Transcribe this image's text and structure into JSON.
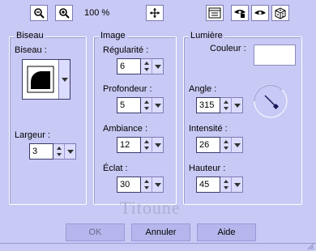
{
  "toolbar": {
    "zoom_out_icon": "zoom-out-icon",
    "zoom_in_icon": "zoom-in-icon",
    "zoom_level": "100 %",
    "pan_icon": "move-icon",
    "preview_icon": "preview-panel-icon",
    "eye_lock_icon": "lock-eye-icon",
    "eye_icon": "eye-icon",
    "random_icon": "dice-icon"
  },
  "biseau": {
    "group_title": "Biseau",
    "bevel_label": "Biseau :",
    "width_label": "Largeur :",
    "width_value": "3"
  },
  "image": {
    "group_title": "Image",
    "regularity_label": "Régularité :",
    "regularity_value": "6",
    "depth_label": "Profondeur :",
    "depth_value": "5",
    "ambient_label": "Ambiance :",
    "ambient_value": "12",
    "shine_label": "Éclat :",
    "shine_value": "30"
  },
  "light": {
    "group_title": "Lumière",
    "color_label": "Couleur :",
    "color_value": "#ffffff",
    "angle_label": "Angle :",
    "angle_value": "315",
    "intensity_label": "Intensité :",
    "intensity_value": "26",
    "height_label": "Hauteur :",
    "height_value": "45"
  },
  "watermark": "Titoune",
  "buttons": {
    "ok": "OK",
    "cancel": "Annuler",
    "help": "Aide"
  },
  "colors": {
    "background": "#c9c9f5",
    "button": "#b6b6ec"
  }
}
